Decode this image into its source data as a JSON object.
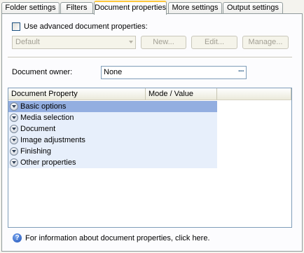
{
  "tabs": [
    {
      "label": "Folder settings",
      "active": false
    },
    {
      "label": "Filters",
      "active": false
    },
    {
      "label": "Document properties",
      "active": true
    },
    {
      "label": "More settings",
      "active": false
    },
    {
      "label": "Output settings",
      "active": false
    }
  ],
  "advanced": {
    "checkbox_label": "Use advanced document properties:",
    "checked": false,
    "combo_value": "Default",
    "new_label": "New...",
    "edit_label": "Edit...",
    "manage_label": "Manage..."
  },
  "owner": {
    "label": "Document owner:",
    "value": "None",
    "browse_label": "···"
  },
  "grid": {
    "columns": [
      "Document Property",
      "Mode / Value"
    ],
    "rows": [
      {
        "label": "Basic options",
        "selected": true
      },
      {
        "label": "Media selection",
        "selected": false
      },
      {
        "label": "Document",
        "selected": false
      },
      {
        "label": "Image adjustments",
        "selected": false
      },
      {
        "label": "Finishing",
        "selected": false
      },
      {
        "label": "Other properties",
        "selected": false
      }
    ]
  },
  "help": {
    "text": "For information about document properties, click here.",
    "icon": "help-question-icon"
  },
  "colors": {
    "active_tab_accent": "#ffc83c",
    "selected_row": "#93aee0",
    "row_background": "#e7effb"
  }
}
